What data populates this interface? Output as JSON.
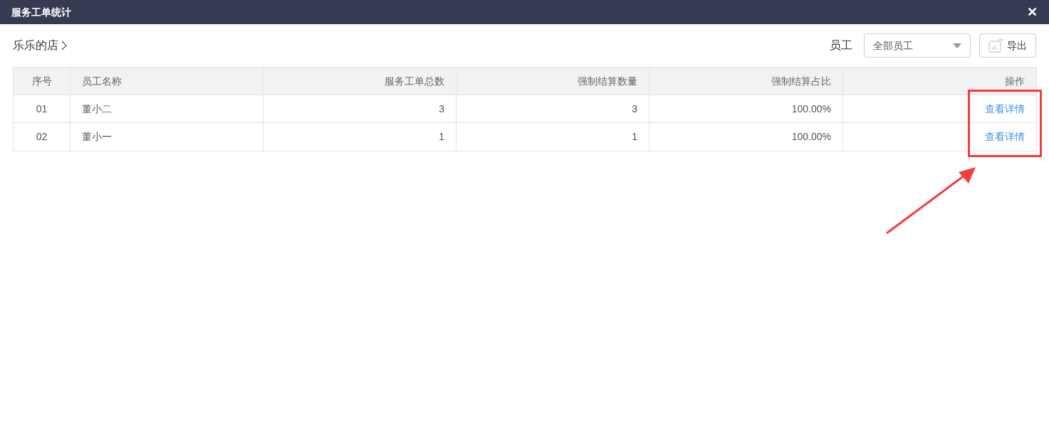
{
  "window": {
    "title": "服务工单统计",
    "close": "✕"
  },
  "breadcrumb": "乐乐的店",
  "filter": {
    "label": "员工",
    "value": "全部员工"
  },
  "export_button": "导出",
  "table": {
    "columns": [
      "序号",
      "员工名称",
      "服务工单总数",
      "强制结算数量",
      "强制结算占比",
      "操作"
    ],
    "rows": [
      {
        "index": "01",
        "name": "董小二",
        "total": "3",
        "forced": "3",
        "ratio": "100.00%",
        "action": "查看详情"
      },
      {
        "index": "02",
        "name": "董小一",
        "total": "1",
        "forced": "1",
        "ratio": "100.00%",
        "action": "查看详情"
      }
    ]
  }
}
